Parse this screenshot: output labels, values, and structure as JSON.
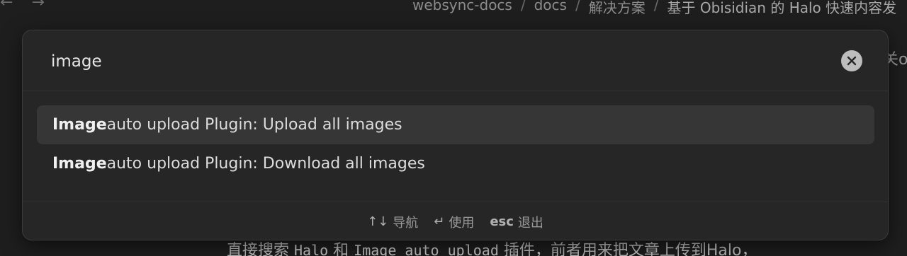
{
  "nav": {
    "back_glyph": "←",
    "forward_glyph": "→"
  },
  "breadcrumb": {
    "items": [
      "websync-docs",
      "docs",
      "解决方案",
      "基于 Obisidian 的 Halo 快速内容发"
    ],
    "separator": "/"
  },
  "background": {
    "peek_text": "关o",
    "line_prefix": "直接搜索 ",
    "code1": "Halo",
    "line_mid": " 和 ",
    "code2": "Image auto upload",
    "line_suffix": " 插件，前者用来把文章上传到Halo，"
  },
  "search": {
    "value": "image",
    "placeholder": ""
  },
  "results": [
    {
      "match": "Image",
      "rest": " auto upload Plugin: Upload all images",
      "selected": true
    },
    {
      "match": "Image",
      "rest": " auto upload Plugin: Download all images",
      "selected": false
    }
  ],
  "footer": {
    "navigate_key": "↑↓",
    "navigate_label": "导航",
    "use_key": "↵",
    "use_label": "使用",
    "esc_key": "esc",
    "esc_label": "退出"
  },
  "colors": {
    "background": "#1e1e1e",
    "modal": "#262626",
    "selected_row": "#363636"
  },
  "icons": [
    "arrow-left-icon",
    "arrow-right-icon",
    "clear-icon",
    "return-icon"
  ]
}
